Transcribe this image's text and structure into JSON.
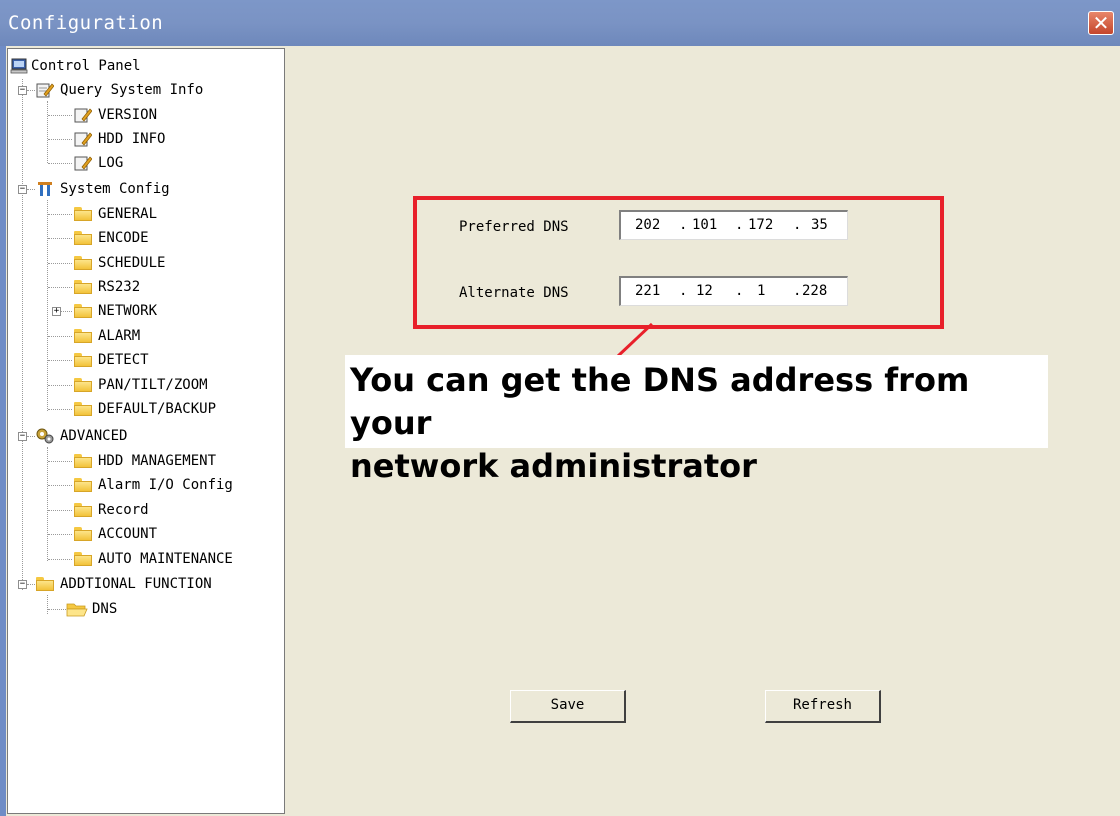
{
  "window": {
    "title": "Configuration",
    "close_glyph": "✕"
  },
  "tree": {
    "root": "Control Panel",
    "query": {
      "label": "Query System Info",
      "items": [
        "VERSION",
        "HDD INFO",
        "LOG"
      ]
    },
    "system": {
      "label": "System Config",
      "items": [
        "GENERAL",
        "ENCODE",
        "SCHEDULE",
        "RS232",
        "NETWORK",
        "ALARM",
        "DETECT",
        "PAN/TILT/ZOOM",
        "DEFAULT/BACKUP"
      ]
    },
    "advanced": {
      "label": "ADVANCED",
      "items": [
        "HDD MANAGEMENT",
        "Alarm I/O Config",
        "Record",
        "ACCOUNT",
        "AUTO MAINTENANCE"
      ]
    },
    "additional": {
      "label": "ADDTIONAL FUNCTION",
      "items": [
        "DNS"
      ]
    },
    "selected": "DNS"
  },
  "dns": {
    "preferred_label": "Preferred DNS",
    "preferred": [
      "202",
      "101",
      "172",
      "35"
    ],
    "alternate_label": "Alternate DNS",
    "alternate": [
      "221",
      "12",
      "1",
      "228"
    ]
  },
  "note": {
    "line1": "You can get the DNS address from your",
    "line2": "network administrator"
  },
  "buttons": {
    "save": "Save",
    "refresh": "Refresh"
  },
  "colors": {
    "title_bar": "#7a93c4",
    "highlight_box": "#e8202a",
    "panel": "#ece9d8"
  }
}
